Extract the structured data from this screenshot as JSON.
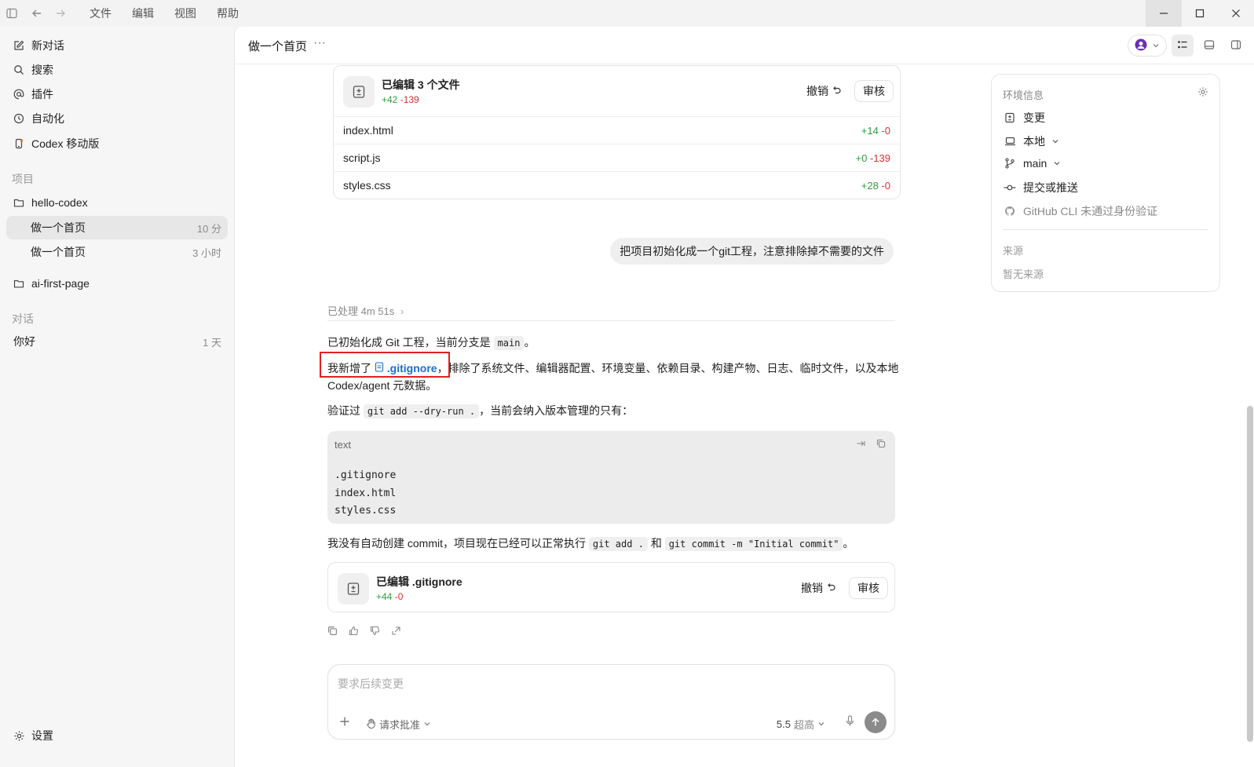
{
  "titlebar": {
    "menu": [
      "文件",
      "编辑",
      "视图",
      "帮助"
    ]
  },
  "sidebar": {
    "new_chat": "新对话",
    "search": "搜索",
    "plugins": "插件",
    "automation": "自动化",
    "mobile": "Codex 移动版",
    "projects_label": "项目",
    "project1": "hello-codex",
    "thread1": {
      "label": "做一个首页",
      "meta": "10 分"
    },
    "thread2": {
      "label": "做一个首页",
      "meta": "3 小时"
    },
    "project2": "ai-first-page",
    "chats_label": "对话",
    "chat1": {
      "label": "你好",
      "meta": "1 天"
    },
    "settings": "设置"
  },
  "header": {
    "title": "做一个首页",
    "more": "···"
  },
  "card1": {
    "title": "已编辑 3 个文件",
    "added": "+42",
    "removed": "-139",
    "undo": "撤销",
    "review": "审核",
    "files": [
      {
        "name": "index.html",
        "added": "+14",
        "removed": "-0"
      },
      {
        "name": "script.js",
        "added": "+0",
        "removed": "-139"
      },
      {
        "name": "styles.css",
        "added": "+28",
        "removed": "-0"
      }
    ]
  },
  "user_message": "把项目初始化成一个git工程，注意排除掉不需要的文件",
  "processed": "已处理 4m 51s",
  "reply": {
    "p1_text": "已初始化成 Git 工程，当前分支是",
    "p1_code": "main",
    "p1_end": "。",
    "p2_prefix": "我新增了",
    "p2_link": ".gitignore",
    "p2_rest": "，排除了系统文件、编辑器配置、环境变量、依赖目录、构建产物、日志、临时文件，以及本地 Codex/agent 元数据。",
    "p3_prefix": "验证过",
    "p3_code": "git add --dry-run .",
    "p3_rest": "，当前会纳入版本管理的只有：",
    "code_lang": "text",
    "code_lines": [
      ".gitignore",
      "index.html",
      "styles.css"
    ],
    "p4_prefix": "我没有自动创建 commit，项目现在已经可以正常执行",
    "p4_code1": "git add .",
    "p4_and": "和",
    "p4_code2": "git commit -m \"Initial commit\"",
    "p4_end": "。"
  },
  "card2": {
    "title": "已编辑 .gitignore",
    "added": "+44",
    "removed": "-0",
    "undo": "撤销",
    "review": "审核"
  },
  "composer": {
    "placeholder": "要求后续变更",
    "approval": "请求批准",
    "model": "5.5",
    "effort": "超高"
  },
  "env": {
    "title": "环境信息",
    "changes": "变更",
    "local": "本地",
    "branch": "main",
    "commit": "提交或推送",
    "github": "GitHub CLI 未通过身份验证",
    "source_label": "来源",
    "source_value": "暂无来源"
  }
}
